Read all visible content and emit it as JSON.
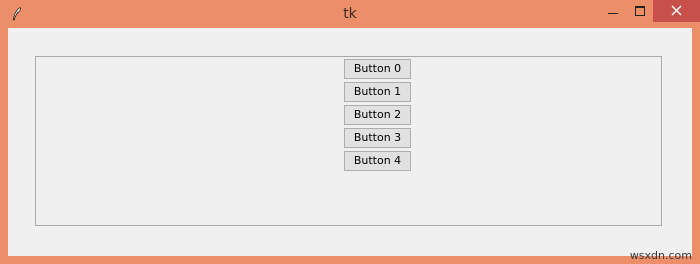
{
  "window": {
    "title": "tk",
    "icon": "tk-feather-icon"
  },
  "titlebar_controls": [
    "minimize-icon",
    "maximize-icon",
    "close-icon"
  ],
  "colors": {
    "titlebar": "#ec8f68",
    "close_button": "#c7514a",
    "client_background": "#f0f0f0",
    "button_face": "#e1e1e1"
  },
  "buttons": [
    "Button 0",
    "Button 1",
    "Button 2",
    "Button 3",
    "Button 4"
  ],
  "watermark": "wsxdn.com"
}
